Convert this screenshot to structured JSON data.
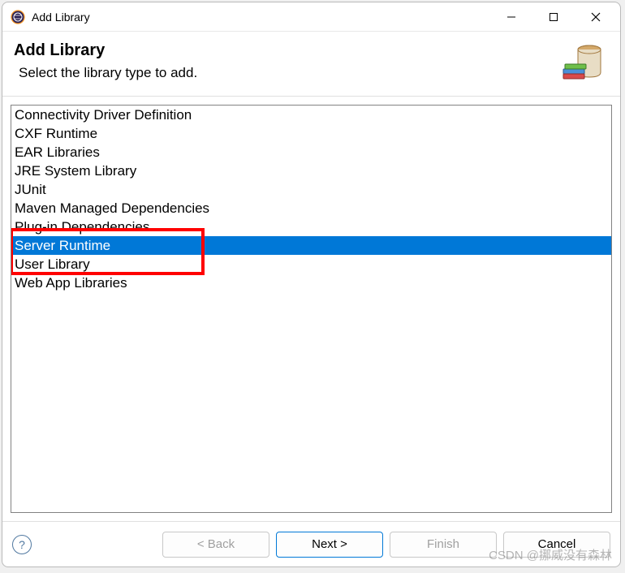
{
  "window": {
    "title": "Add Library"
  },
  "header": {
    "title": "Add Library",
    "subtitle": "Select the library type to add."
  },
  "list": {
    "items": [
      "Connectivity Driver Definition",
      "CXF Runtime",
      "EAR Libraries",
      "JRE System Library",
      "JUnit",
      "Maven Managed Dependencies",
      "Plug-in Dependencies",
      "Server Runtime",
      "User Library",
      "Web App Libraries"
    ],
    "selected_index": 7
  },
  "buttons": {
    "back": "< Back",
    "next": "Next >",
    "finish": "Finish",
    "cancel": "Cancel"
  },
  "watermark": "CSDN @挪威没有森林"
}
